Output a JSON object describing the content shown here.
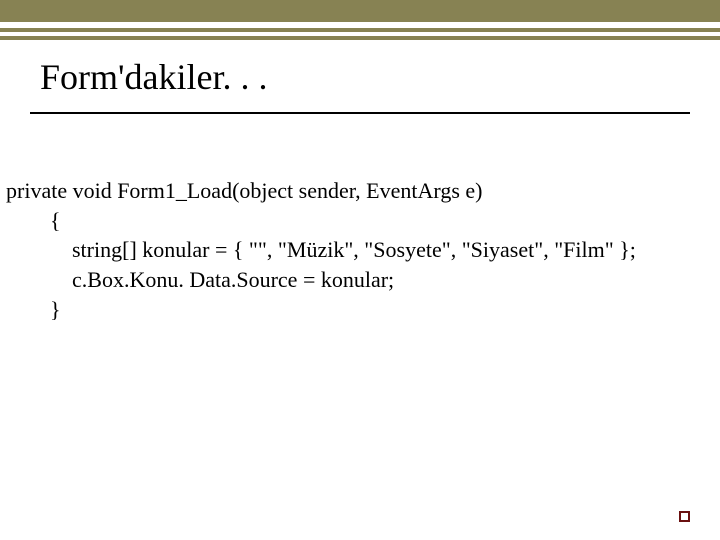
{
  "title": "Form'dakiler. . .",
  "code": {
    "line1": "private void Form1_Load(object sender, EventArgs e)",
    "line2": "        {",
    "line3": "            string[] konular = { \"\", \"Müzik\", \"Sosyete\", \"Siyaset\", \"Film\" };",
    "line4": "            c.Box.Konu. Data.Source = konular;",
    "line5": "        }"
  }
}
